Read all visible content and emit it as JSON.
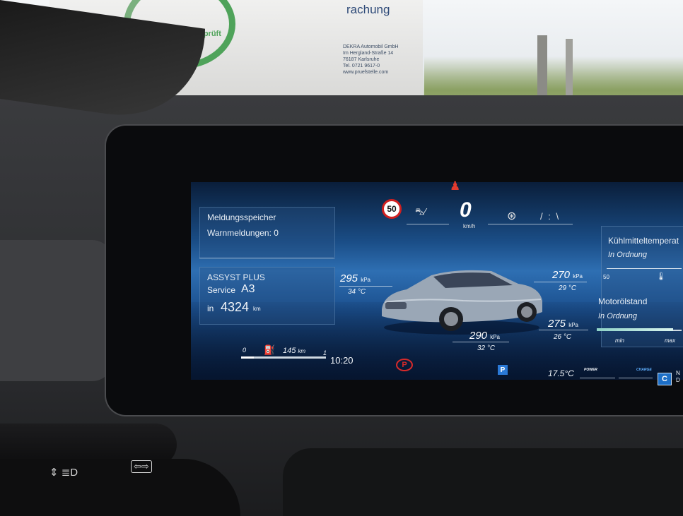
{
  "outside": {
    "van_top_text": "rachung",
    "van_sticker": "geprüft",
    "van_company_lines": [
      "DEKRA Automobil GmbH",
      "Im Hergland-Straße 14",
      "76187 Karlsruhe",
      "Tel. 0721 9617-0",
      "www.pruefstelle.com"
    ]
  },
  "cluster": {
    "speed_limit": "50",
    "speed_value": "0",
    "speed_unit": "km/h",
    "message_panel": {
      "title": "Meldungsspeicher",
      "warnings": "Warnmeldungen: 0"
    },
    "service_panel": {
      "title": "ASSYST PLUS",
      "service_label": "Service",
      "service_code": "A3",
      "in_label": "in",
      "distance": "4324",
      "distance_unit": "km"
    },
    "tires": {
      "front_left": {
        "pressure": "295",
        "unit": "kPa",
        "temp": "34 °C"
      },
      "front_right": {
        "pressure": "270",
        "unit": "kPa",
        "temp": "29 °C"
      },
      "rear_left": {
        "pressure": "290",
        "unit": "kPa",
        "temp": "32 °C"
      },
      "rear_right": {
        "pressure": "275",
        "unit": "kPa",
        "temp": "26 °C"
      }
    },
    "bottom": {
      "fuel_min": "0",
      "range": "145",
      "range_unit": "km",
      "fuel_max": "1",
      "fuel_level": 0.15,
      "time": "10:20",
      "parking_brake": "P",
      "gear": "P",
      "outside_temp": "17.5°C",
      "power_label": "POWER",
      "charge_label": "CHARGE",
      "drive_mode": "C",
      "drive_mode_partial": "N\nD"
    },
    "coolant": {
      "title": "Kühlmitteltemperat",
      "status": "In Ordnung",
      "scale_min": "50"
    },
    "oil": {
      "title": "Motorölstand",
      "status": "In Ordnung",
      "min_label": "min",
      "max_label": "max",
      "level": 0.9
    }
  },
  "colors": {
    "warning_red": "#d82a2a",
    "cluster_blue": "#2e6fb3",
    "gear_blue": "#2a79d6"
  },
  "stalk": {
    "arrow_icon": "⇦⇨"
  }
}
